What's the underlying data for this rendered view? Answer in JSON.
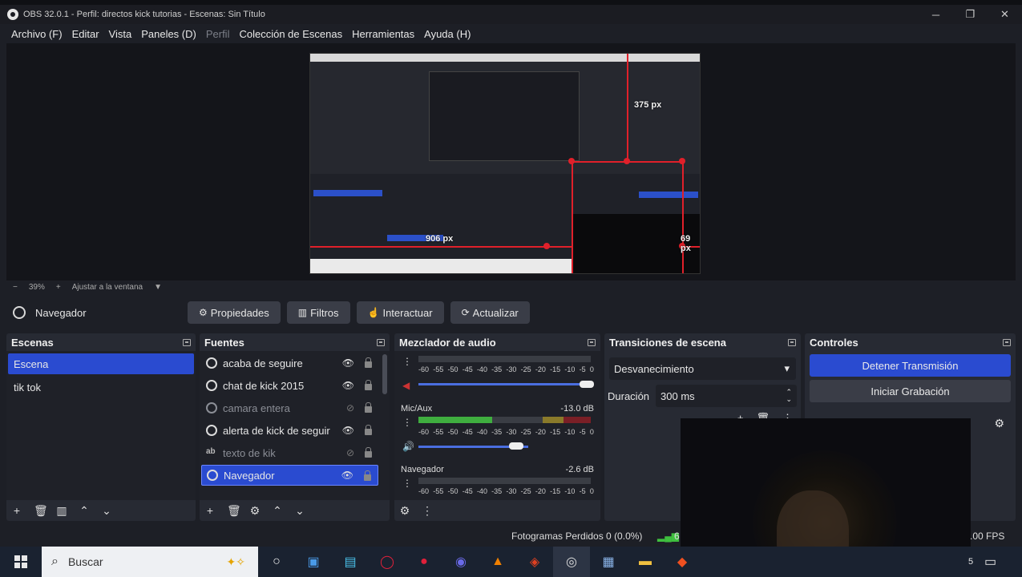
{
  "window": {
    "title": "OBS 32.0.1 - Perfil: directos kick tutorias - Escenas: Sin Título",
    "min": "─",
    "max": "❐",
    "close": "✕"
  },
  "menu": [
    "Archivo (F)",
    "Editar",
    "Vista",
    "Paneles (D)",
    "Perfil",
    "Colección de Escenas",
    "Herramientas",
    "Ayuda (H)"
  ],
  "preview": {
    "labels": {
      "top": "375 px",
      "left": "906 px",
      "right": "69 px"
    }
  },
  "zoom": {
    "minus": "−",
    "value": "39%",
    "plus": "+",
    "fit": "Ajustar a la ventana",
    "caret": "▼"
  },
  "context": {
    "source": "Navegador",
    "buttons": [
      {
        "icon": "gear-icon",
        "glyph": "⚙",
        "label": "Propiedades"
      },
      {
        "icon": "filter-icon",
        "glyph": "▥",
        "label": "Filtros"
      },
      {
        "icon": "hand-icon",
        "glyph": "☝",
        "label": "Interactuar"
      },
      {
        "icon": "refresh-icon",
        "glyph": "⟳",
        "label": "Actualizar"
      }
    ]
  },
  "scenes": {
    "title": "Escenas",
    "items": [
      {
        "label": "Escena",
        "selected": true
      },
      {
        "label": "tik tok",
        "selected": false
      }
    ]
  },
  "sources": {
    "title": "Fuentes",
    "items": [
      {
        "label": "acaba de seguire",
        "hidden": false,
        "type": "browser"
      },
      {
        "label": "chat de kick 2015",
        "hidden": false,
        "type": "browser"
      },
      {
        "label": "camara entera",
        "hidden": true,
        "type": "browser"
      },
      {
        "label": "alerta de kick de seguir",
        "hidden": false,
        "type": "browser"
      },
      {
        "label": "texto de kik",
        "hidden": true,
        "type": "text"
      },
      {
        "label": "Navegador",
        "hidden": false,
        "type": "browser",
        "selected": true
      }
    ],
    "text_icon": "ab"
  },
  "mixer": {
    "title": "Mezclador de audio",
    "ticks": [
      "-60",
      "-55",
      "-50",
      "-45",
      "-40",
      "-35",
      "-30",
      "-25",
      "-20",
      "-15",
      "-10",
      "-5",
      "0"
    ],
    "channels": [
      {
        "name": "",
        "db": "",
        "level": 0
      },
      {
        "name": "Mic/Aux",
        "db": "-13.0 dB",
        "level": 0.43,
        "volume": 0.65
      },
      {
        "name": "Navegador",
        "db": "-2.6 dB",
        "level": 0
      }
    ]
  },
  "transitions": {
    "title": "Transiciones de escena",
    "selected": "Desvanecimiento",
    "duration_label": "Duración",
    "duration_value": "300 ms"
  },
  "controls": {
    "title": "Controles",
    "buttons": [
      "Detener Transmisión",
      "Iniciar Grabación"
    ]
  },
  "status": {
    "dropped_frames": "Fotogramas Perdidos 0 (0.0%)",
    "fps": ".00 FPS",
    "partial_number": "6"
  },
  "taskbar": {
    "search_placeholder": "Buscar",
    "apps": [
      "cortana-icon",
      "store-icon",
      "photos-icon",
      "opera-gx-icon",
      "opera-icon",
      "vivaldi-icon",
      "vlc-icon",
      "game-icon",
      "obs-icon",
      "files-icon",
      "explorer-icon",
      "brave-icon"
    ],
    "tray_partial": "5"
  },
  "colors": {
    "accent": "#2a4bd0",
    "panel": "#272a33",
    "bg": "#1d1f26",
    "red_guide": "#e0202a"
  }
}
